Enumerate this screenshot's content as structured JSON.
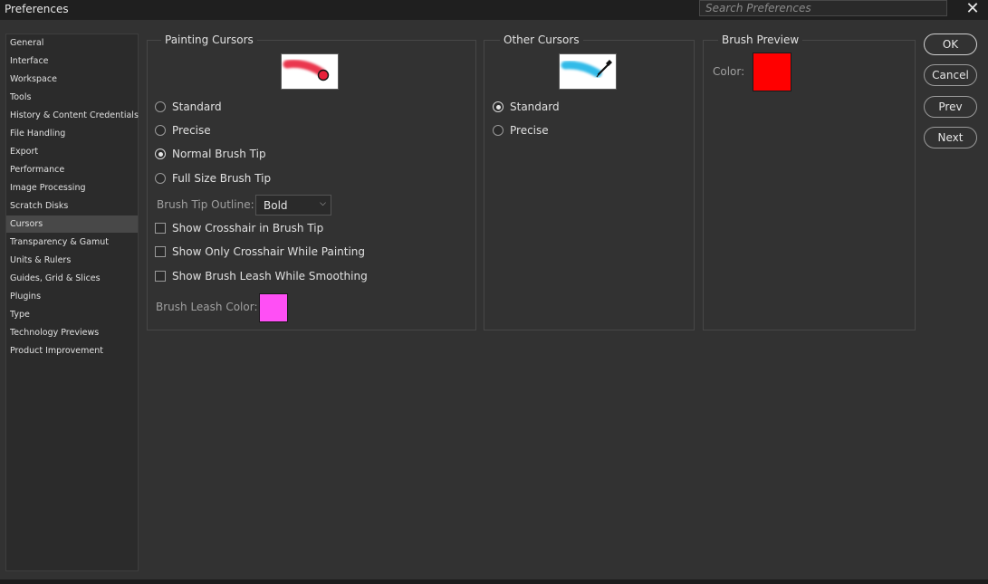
{
  "window": {
    "title": "Preferences",
    "close_glyph": "✕"
  },
  "search": {
    "placeholder": "Search Preferences"
  },
  "sidebar": {
    "items": [
      {
        "label": "General"
      },
      {
        "label": "Interface"
      },
      {
        "label": "Workspace"
      },
      {
        "label": "Tools"
      },
      {
        "label": "History & Content Credentials"
      },
      {
        "label": "File Handling"
      },
      {
        "label": "Export"
      },
      {
        "label": "Performance"
      },
      {
        "label": "Image Processing"
      },
      {
        "label": "Scratch Disks"
      },
      {
        "label": "Cursors",
        "active": true
      },
      {
        "label": "Transparency & Gamut"
      },
      {
        "label": "Units & Rulers"
      },
      {
        "label": "Guides, Grid & Slices"
      },
      {
        "label": "Plugins"
      },
      {
        "label": "Type"
      },
      {
        "label": "Technology Previews"
      },
      {
        "label": "Product Improvement"
      }
    ]
  },
  "painting_cursors": {
    "title": "Painting Cursors",
    "options": [
      {
        "label": "Standard",
        "selected": false
      },
      {
        "label": "Precise",
        "selected": false
      },
      {
        "label": "Normal Brush Tip",
        "selected": true
      },
      {
        "label": "Full Size Brush Tip",
        "selected": false
      }
    ],
    "brush_tip_outline_label": "Brush Tip Outline:",
    "brush_tip_outline_value": "Bold",
    "checkboxes": [
      {
        "label": "Show Crosshair in Brush Tip",
        "checked": false
      },
      {
        "label": "Show Only Crosshair While Painting",
        "checked": false
      },
      {
        "label": "Show Brush Leash While Smoothing",
        "checked": false
      }
    ],
    "leash_color_label": "Brush Leash Color:",
    "leash_color": "#ff4ff5"
  },
  "other_cursors": {
    "title": "Other Cursors",
    "options": [
      {
        "label": "Standard",
        "selected": true
      },
      {
        "label": "Precise",
        "selected": false
      }
    ]
  },
  "brush_preview": {
    "title": "Brush Preview",
    "color_label": "Color:",
    "color": "#ff0000"
  },
  "buttons": {
    "ok": "OK",
    "cancel": "Cancel",
    "prev": "Prev",
    "next": "Next"
  }
}
